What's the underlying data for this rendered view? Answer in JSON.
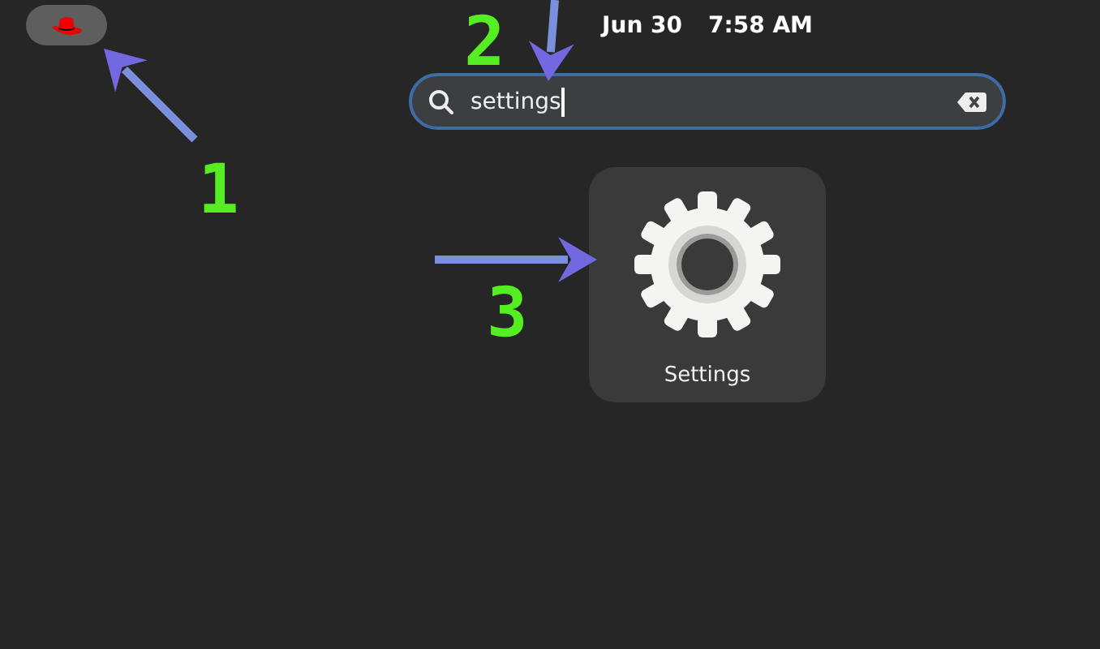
{
  "top_bar": {
    "date": "Jun 30",
    "time": "7:58 AM"
  },
  "search": {
    "value": "settings",
    "focused": true
  },
  "results": [
    {
      "label": "Settings",
      "selected": true
    }
  ],
  "annotations": [
    {
      "label": "1"
    },
    {
      "label": "2"
    },
    {
      "label": "3"
    }
  ]
}
